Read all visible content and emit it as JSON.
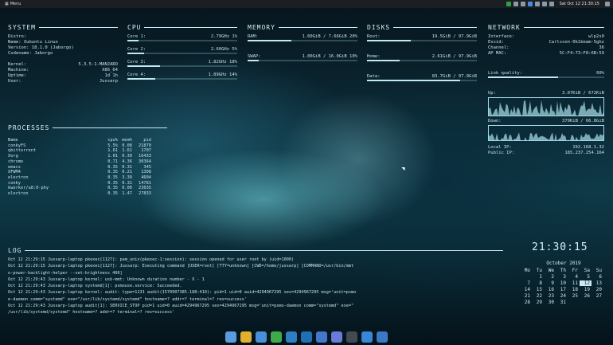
{
  "topbar": {
    "menu_label": "Menu",
    "clock": "Sat Oct 12 21:30:15"
  },
  "system": {
    "title": "SYSTEM",
    "rows": [
      {
        "k": "Distro:",
        "v": ""
      },
      {
        "k": "Name: Xubuntu Linux",
        "v": ""
      },
      {
        "k": "Version: 18.1.0 (Jaborgo)",
        "v": ""
      },
      {
        "k": "Codename: Jaborgo",
        "v": ""
      },
      {
        "k": "",
        "v": ""
      },
      {
        "k": "Kernel:",
        "v": "5.3.5-1-MANJARO"
      },
      {
        "k": "Machine:",
        "v": "X86_64"
      },
      {
        "k": "Uptime:",
        "v": "1d 1h"
      },
      {
        "k": "User:",
        "v": "Jussarp"
      }
    ]
  },
  "cpu": {
    "title": "CPU",
    "cores": [
      {
        "label": "Core 1:",
        "freq": "2.79GHz 1%",
        "fill": 0.1
      },
      {
        "label": "Core 2:",
        "freq": "2.60GHz 5%",
        "fill": 0.15
      },
      {
        "label": "Core 3:",
        "freq": "1.82GHz 18%",
        "fill": 0.3
      },
      {
        "label": "Core 4:",
        "freq": "1.89GHz 14%",
        "fill": 0.25
      }
    ]
  },
  "memory": {
    "title": "MEMORY",
    "items": [
      {
        "label": "RAM:",
        "value": "1.60GiB / 7.66GiB 20%",
        "fill": 0.4
      },
      {
        "label": "SWAP:",
        "value": "1.00GiB / 16.0GiB 10%",
        "fill": 0.1
      }
    ]
  },
  "disks": {
    "title": "DISKS",
    "items": [
      {
        "label": "Root:",
        "value": "19.5GiB / 97.9GiB",
        "fill": 0.4
      },
      {
        "label": "Home:",
        "value": "2.61GiB / 97.9GiB",
        "fill": 0.3
      },
      {
        "label": "Data:",
        "value": "83.7GiB / 97.9GiB",
        "fill": 0.85
      }
    ]
  },
  "network": {
    "title": "NETWORK",
    "rows": [
      {
        "k": "Interface:",
        "v": "wlp2s0"
      },
      {
        "k": "Essid:",
        "v": "Carlsson-0k1beam-5ghz"
      },
      {
        "k": "Channel:",
        "v": "36"
      },
      {
        "k": "AP MAC:",
        "v": "5C:F4:73:F8:6B:59"
      }
    ],
    "link_quality_label": "Link quality:",
    "link_quality_value": "60%",
    "link_quality_fill": 0.6,
    "up_label": "Up:",
    "up_value": "3.07KiB / 672KiB",
    "down_label": "Down:",
    "down_value": "379KiB / 66.8GiB",
    "local_ip_label": "Local IP:",
    "local_ip_value": "192.168.1.32",
    "public_ip_label": "Public IP:",
    "public_ip_value": "185.237.254.164"
  },
  "processes": {
    "title": "PROCESSES",
    "headers": [
      "Name",
      "cpu%",
      "mem%",
      "pid"
    ],
    "rows": [
      [
        "conkyFS",
        "5.5%",
        "0.08",
        "21870"
      ],
      [
        "qbittorrent",
        "1.61",
        "1.61",
        "1707"
      ],
      [
        "Xorg",
        "1.01",
        "0.39",
        "16433"
      ],
      [
        "chrome",
        "0.71",
        "4.36",
        "30364"
      ],
      [
        "emacs",
        "0.35",
        "0.31",
        "345"
      ],
      [
        "XFWM4",
        "0.35",
        "0.21",
        "1308"
      ],
      [
        "electron",
        "0.35",
        "3.39",
        "4604"
      ],
      [
        "conky",
        "0.35",
        "0.31",
        "14781"
      ],
      [
        "kworker/u8:0-phy",
        "0.35",
        "0.00",
        "23035"
      ],
      [
        "electron",
        "0.35",
        "1.47",
        "27833"
      ]
    ]
  },
  "log": {
    "title": "LOG",
    "lines": [
      "Oct 12 21:29:15 Jussarp-laptop pkexec[1127]: pam_unix(pkexec-1:session): session opened for user root by (uid=1000)",
      "Oct 12 21:29:15 Jussarp-laptop pkexec[1127]: Jussarp: Executing command [USER=root] [TTY=unknown] [CWD=/home/jussarp] [COMMAND=/usr/bin/mmt",
      "o-power-backlight-helper --set-brightness 400]",
      "Oct 12 21:29:43 Jussarp-laptop kernel: usb-mmt: Unknown duration number - X - 1",
      "Oct 12 21:29:43 Jussarp-laptop systemd[1]: psmouse.service: Succeeded.",
      "Oct 12 21:29:43 Jussarp-laptop kernel: audit: type=1131 audit(1570907385.188:410): pid=1 uid=0 auid=4294967295 ses=4294967295 msg='unit=psmo",
      "e-daemon comm=\"systemd\" exe=\"/usr/lib/systemd/systemd\" hostname=? addr=? terminal=? res=success'",
      "Oct 12 21:29:43 Jussarp-laptop audit[1]: SERVICE_STOP pid=1 uid=0 auid=4294967295 ses=4294967295 msg='unit=psmo-daemon comm=\"systemd\" exe=\"",
      "/usr/lib/systemd/systemd\" hostname=? addr=? terminal=? res=success'"
    ]
  },
  "clock": {
    "time": "21:30:15",
    "month": "October 2019",
    "weekdays": [
      "Mo",
      "Tu",
      "We",
      "Th",
      "Fr",
      "Sa",
      "Su"
    ],
    "days": [
      "",
      "1",
      "2",
      "3",
      "4",
      "5",
      "6",
      "7",
      "8",
      "9",
      "10",
      "11",
      "12",
      "13",
      "14",
      "15",
      "16",
      "17",
      "18",
      "19",
      "20",
      "21",
      "22",
      "23",
      "24",
      "25",
      "26",
      "27",
      "28",
      "29",
      "30",
      "31",
      "",
      "",
      ""
    ],
    "today": "12"
  },
  "dock": {
    "icons": [
      {
        "name": "files-icon",
        "color": "#5a9be0"
      },
      {
        "name": "chrome-icon",
        "color": "#e0b030"
      },
      {
        "name": "mail-icon",
        "color": "#4a90d9"
      },
      {
        "name": "libreoffice-icon",
        "color": "#3eaa4a"
      },
      {
        "name": "code-icon",
        "color": "#2d7fc4"
      },
      {
        "name": "vscode-icon",
        "color": "#1f6fb5"
      },
      {
        "name": "settings-icon",
        "color": "#4477cc"
      },
      {
        "name": "gmail-icon",
        "color": "#6a7ad8"
      },
      {
        "name": "terminal-icon",
        "color": "#444a52"
      },
      {
        "name": "network-icon",
        "color": "#3a86d6"
      },
      {
        "name": "keyboard-icon",
        "color": "#3c78c8"
      }
    ]
  }
}
